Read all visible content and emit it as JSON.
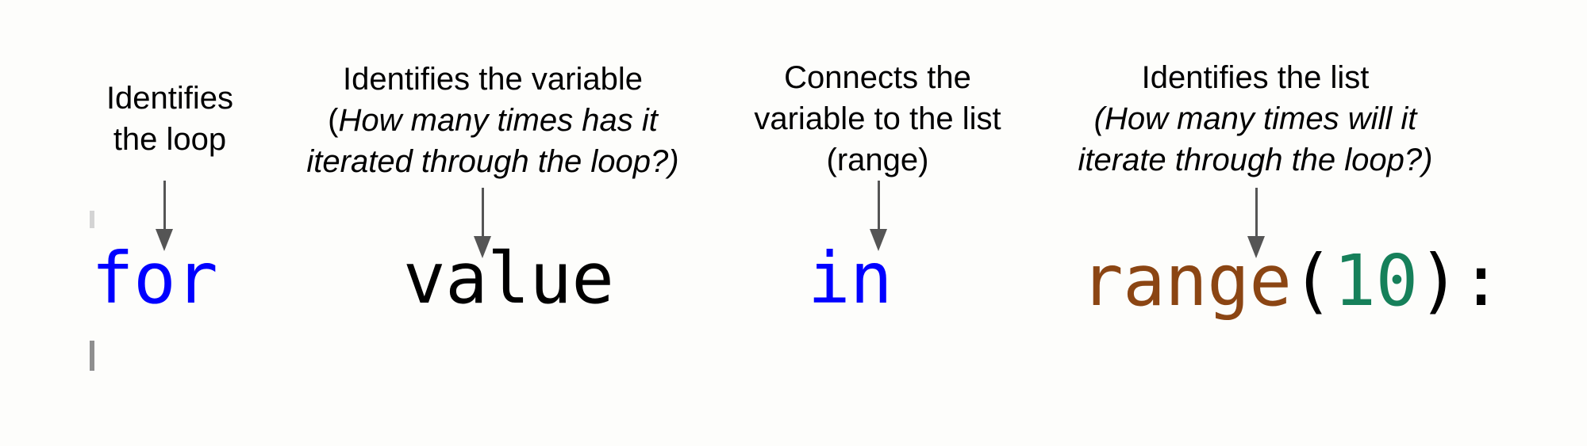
{
  "annotations": [
    {
      "id": "loop",
      "lines": [
        {
          "text": "Identifies"
        },
        {
          "text": "the loop"
        }
      ]
    },
    {
      "id": "variable",
      "lines": [
        {
          "text": "Identifies the variable"
        },
        {
          "open": "(",
          "text": "How many times has it"
        },
        {
          "text": "iterated through the loop?)"
        }
      ]
    },
    {
      "id": "connector",
      "lines": [
        {
          "text": "Connects the"
        },
        {
          "text": "variable to the list"
        },
        {
          "text": "(range)"
        }
      ]
    },
    {
      "id": "list",
      "lines": [
        {
          "text": "Identifies the list"
        },
        {
          "text": "(How many times will it"
        },
        {
          "text": "iterate through the loop?)"
        }
      ]
    }
  ],
  "code": {
    "keyword_for": "for",
    "variable": "value",
    "keyword_in": "in",
    "builtin": "range",
    "open_paren": "(",
    "number": "10",
    "close_paren_colon": "):"
  },
  "colors": {
    "keyword": "#0000ff",
    "variable": "#000000",
    "builtin": "#8b4513",
    "number": "#16805a",
    "punctuation": "#000000",
    "arrow": "#555555"
  }
}
